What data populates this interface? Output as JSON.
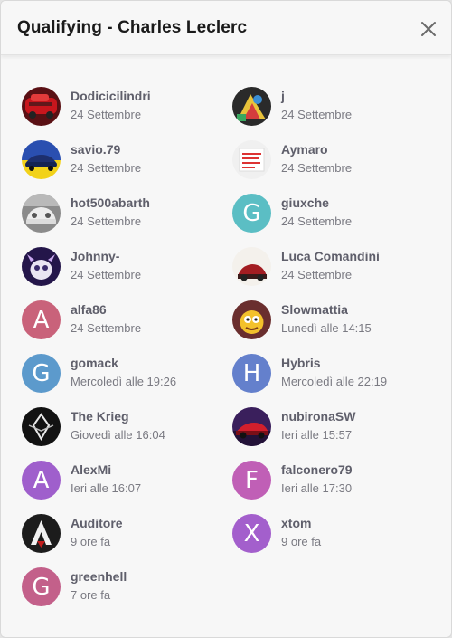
{
  "modal": {
    "title": "Qualifying - Charles Leclerc",
    "close_icon": "close-x-icon"
  },
  "users": [
    {
      "name": "Dodicicilindri",
      "date": "24 Settembre",
      "avatar": "image",
      "avatar_desc": "red-car-photo"
    },
    {
      "name": "j",
      "date": "24 Settembre",
      "avatar": "image",
      "avatar_desc": "colorful-illustration"
    },
    {
      "name": "savio.79",
      "date": "24 Settembre",
      "avatar": "image",
      "avatar_desc": "blue-car-photo"
    },
    {
      "name": "Aymaro",
      "date": "24 Settembre",
      "avatar": "image",
      "avatar_desc": "text-sign-image"
    },
    {
      "name": "hot500abarth",
      "date": "24 Settembre",
      "avatar": "image",
      "avatar_desc": "white-car-photo"
    },
    {
      "name": "giuxche",
      "date": "24 Settembre",
      "avatar": "letter",
      "letter": "G",
      "color": "#5bbec4"
    },
    {
      "name": "Johnny-",
      "date": "24 Settembre",
      "avatar": "image",
      "avatar_desc": "cartoon-creature"
    },
    {
      "name": "Luca Comandini",
      "date": "24 Settembre",
      "avatar": "image",
      "avatar_desc": "car-photo"
    },
    {
      "name": "alfa86",
      "date": "24 Settembre",
      "avatar": "letter",
      "letter": "A",
      "color": "#c9627a"
    },
    {
      "name": "Slowmattia",
      "date": "Lunedì alle 14:15",
      "avatar": "image",
      "avatar_desc": "cartoon-character"
    },
    {
      "name": "gomack",
      "date": "Mercoledì alle 19:26",
      "avatar": "letter",
      "letter": "G",
      "color": "#5c9acc"
    },
    {
      "name": "Hybris",
      "date": "Mercoledì alle 22:19",
      "avatar": "letter",
      "letter": "H",
      "color": "#6480cc"
    },
    {
      "name": "The Krieg",
      "date": "Giovedì alle 16:04",
      "avatar": "image",
      "avatar_desc": "dark-logo"
    },
    {
      "name": "nubironaSW",
      "date": "Ieri alle 15:57",
      "avatar": "image",
      "avatar_desc": "race-car-photo"
    },
    {
      "name": "AlexMi",
      "date": "Ieri alle 16:07",
      "avatar": "letter",
      "letter": "A",
      "color": "#9f5fcc"
    },
    {
      "name": "falconero79",
      "date": "Ieri alle 17:30",
      "avatar": "letter",
      "letter": "F",
      "color": "#c05fb6"
    },
    {
      "name": "Auditore",
      "date": "9 ore fa",
      "avatar": "image",
      "avatar_desc": "assassin-logo"
    },
    {
      "name": "xtom",
      "date": "9 ore fa",
      "avatar": "letter",
      "letter": "X",
      "color": "#a35fcc"
    },
    {
      "name": "greenhell",
      "date": "7 ore fa",
      "avatar": "letter",
      "letter": "G",
      "color": "#c3608a"
    }
  ]
}
